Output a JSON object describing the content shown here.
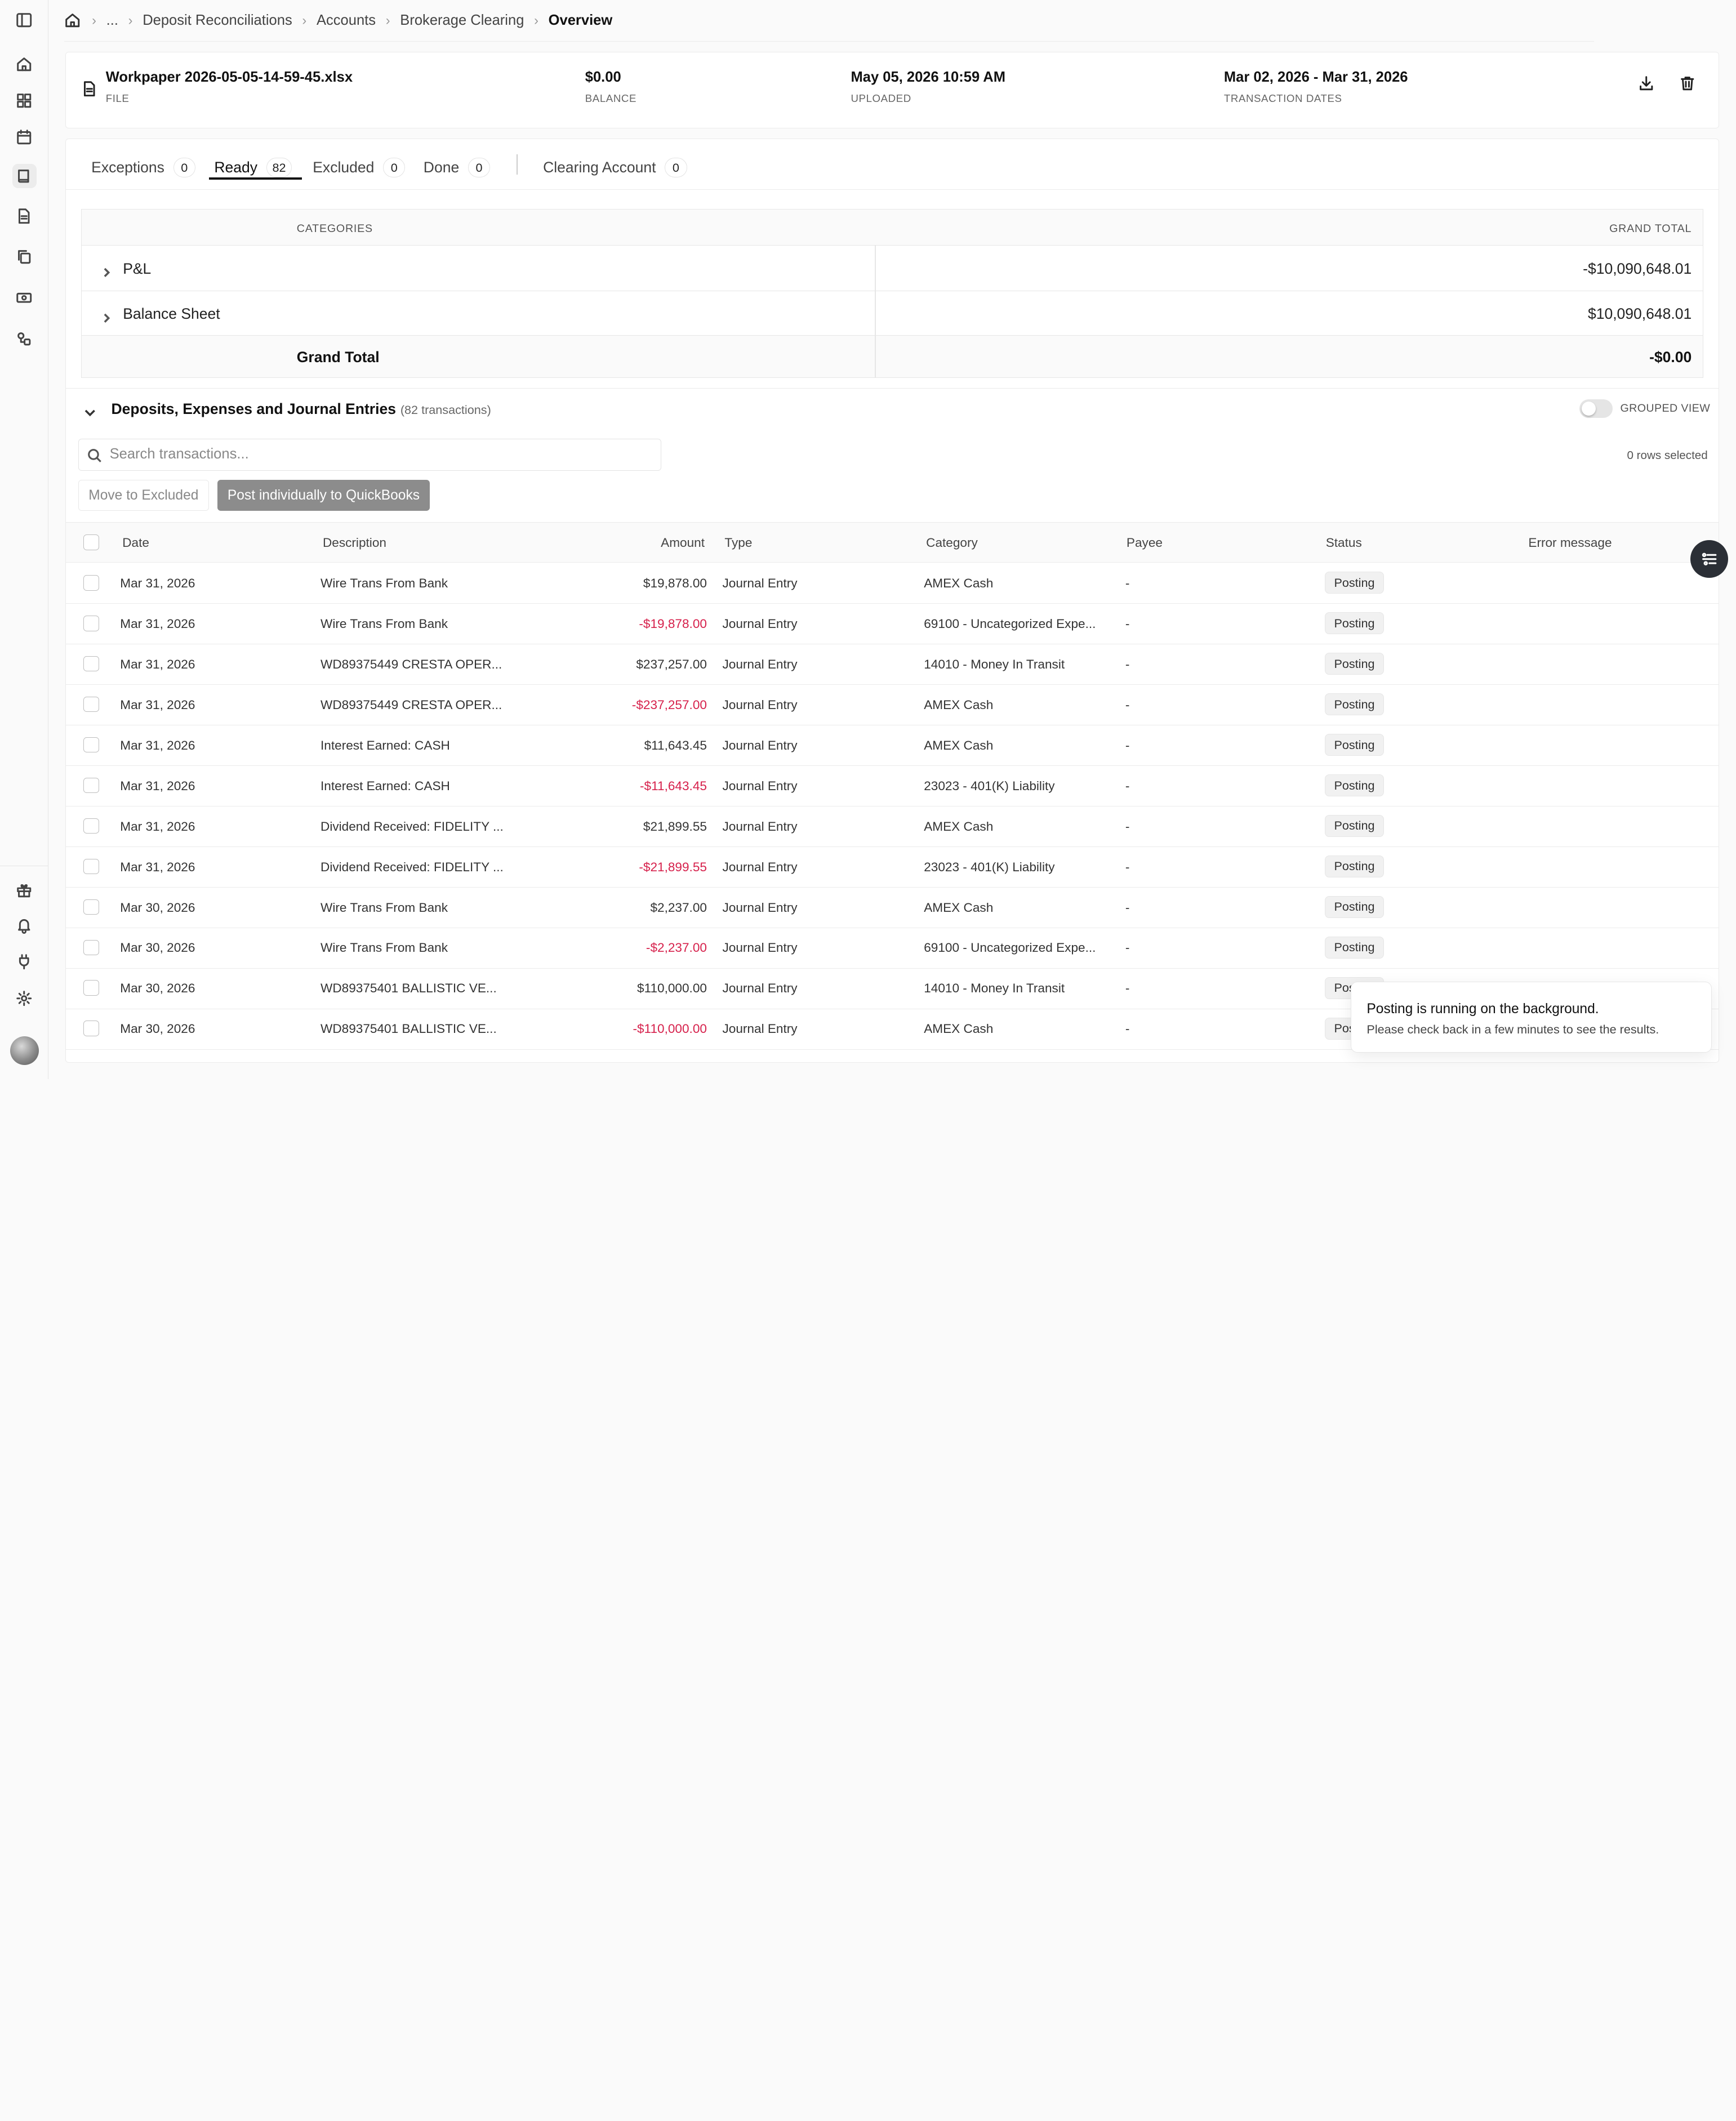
{
  "breadcrumb": {
    "ellipsis": "...",
    "items": [
      "Deposit Reconciliations",
      "Accounts",
      "Brokerage Clearing"
    ],
    "current": "Overview"
  },
  "file_card": {
    "file_name": "Workpaper 2026-05-05-14-59-45.xlsx",
    "file_label": "FILE",
    "balance": "$0.00",
    "balance_label": "BALANCE",
    "uploaded": "May 05, 2026 10:59 AM",
    "uploaded_label": "UPLOADED",
    "dates": "Mar 02, 2026 - Mar 31, 2026",
    "dates_label": "TRANSACTION DATES"
  },
  "tabs": [
    {
      "label": "Exceptions",
      "count": "0"
    },
    {
      "label": "Ready",
      "count": "82"
    },
    {
      "label": "Excluded",
      "count": "0"
    },
    {
      "label": "Done",
      "count": "0"
    },
    {
      "label": "Clearing Account",
      "count": "0"
    }
  ],
  "active_tab": "Ready",
  "categories": {
    "header_left": "CATEGORIES",
    "header_right": "GRAND TOTAL",
    "rows": [
      {
        "name": "P&L",
        "total": "-$10,090,648.01"
      },
      {
        "name": "Balance Sheet",
        "total": "$10,090,648.01"
      }
    ],
    "grand_total_label": "Grand Total",
    "grand_total": "-$0.00"
  },
  "section": {
    "title": "Deposits, Expenses and Journal Entries",
    "count": "(82 transactions)",
    "toggle_label": "GROUPED VIEW",
    "search_placeholder": "Search transactions...",
    "rows_selected": "0 rows selected",
    "move_btn": "Move to Excluded",
    "post_btn": "Post individually to QuickBooks"
  },
  "columns": {
    "date": "Date",
    "description": "Description",
    "amount": "Amount",
    "type": "Type",
    "category": "Category",
    "payee": "Payee",
    "status": "Status",
    "error": "Error message"
  },
  "transactions": [
    {
      "date": "Mar 31, 2026",
      "description": "Wire Trans From Bank",
      "amount": "$19,878.00",
      "negative": false,
      "type": "Journal Entry",
      "category": "AMEX Cash",
      "payee": "-",
      "status": "Posting"
    },
    {
      "date": "Mar 31, 2026",
      "description": "Wire Trans From Bank",
      "amount": "-$19,878.00",
      "negative": true,
      "type": "Journal Entry",
      "category": "69100 - Uncategorized Expe...",
      "payee": "-",
      "status": "Posting"
    },
    {
      "date": "Mar 31, 2026",
      "description": "WD89375449 CRESTA OPER...",
      "amount": "$237,257.00",
      "negative": false,
      "type": "Journal Entry",
      "category": "14010 - Money In Transit",
      "payee": "-",
      "status": "Posting"
    },
    {
      "date": "Mar 31, 2026",
      "description": "WD89375449 CRESTA OPER...",
      "amount": "-$237,257.00",
      "negative": true,
      "type": "Journal Entry",
      "category": "AMEX Cash",
      "payee": "-",
      "status": "Posting"
    },
    {
      "date": "Mar 31, 2026",
      "description": "Interest Earned: CASH",
      "amount": "$11,643.45",
      "negative": false,
      "type": "Journal Entry",
      "category": "AMEX Cash",
      "payee": "-",
      "status": "Posting"
    },
    {
      "date": "Mar 31, 2026",
      "description": "Interest Earned: CASH",
      "amount": "-$11,643.45",
      "negative": true,
      "type": "Journal Entry",
      "category": "23023 - 401(K) Liability",
      "payee": "-",
      "status": "Posting"
    },
    {
      "date": "Mar 31, 2026",
      "description": "Dividend Received: FIDELITY ...",
      "amount": "$21,899.55",
      "negative": false,
      "type": "Journal Entry",
      "category": "AMEX Cash",
      "payee": "-",
      "status": "Posting"
    },
    {
      "date": "Mar 31, 2026",
      "description": "Dividend Received: FIDELITY ...",
      "amount": "-$21,899.55",
      "negative": true,
      "type": "Journal Entry",
      "category": "23023 - 401(K) Liability",
      "payee": "-",
      "status": "Posting"
    },
    {
      "date": "Mar 30, 2026",
      "description": "Wire Trans From Bank",
      "amount": "$2,237.00",
      "negative": false,
      "type": "Journal Entry",
      "category": "AMEX Cash",
      "payee": "-",
      "status": "Posting"
    },
    {
      "date": "Mar 30, 2026",
      "description": "Wire Trans From Bank",
      "amount": "-$2,237.00",
      "negative": true,
      "type": "Journal Entry",
      "category": "69100 - Uncategorized Expe...",
      "payee": "-",
      "status": "Posting"
    },
    {
      "date": "Mar 30, 2026",
      "description": "WD89375401 BALLISTIC VE...",
      "amount": "$110,000.00",
      "negative": false,
      "type": "Journal Entry",
      "category": "14010 - Money In Transit",
      "payee": "-",
      "status": "Posting"
    },
    {
      "date": "Mar 30, 2026",
      "description": "WD89375401 BALLISTIC VE...",
      "amount": "-$110,000.00",
      "negative": true,
      "type": "Journal Entry",
      "category": "AMEX Cash",
      "payee": "-",
      "status": "Posting"
    }
  ],
  "toast": {
    "title": "Posting is running on the background.",
    "message": "Please check back in a few minutes to see the results."
  },
  "colors": {
    "negative": "#d6204b",
    "accent": "#111111"
  }
}
